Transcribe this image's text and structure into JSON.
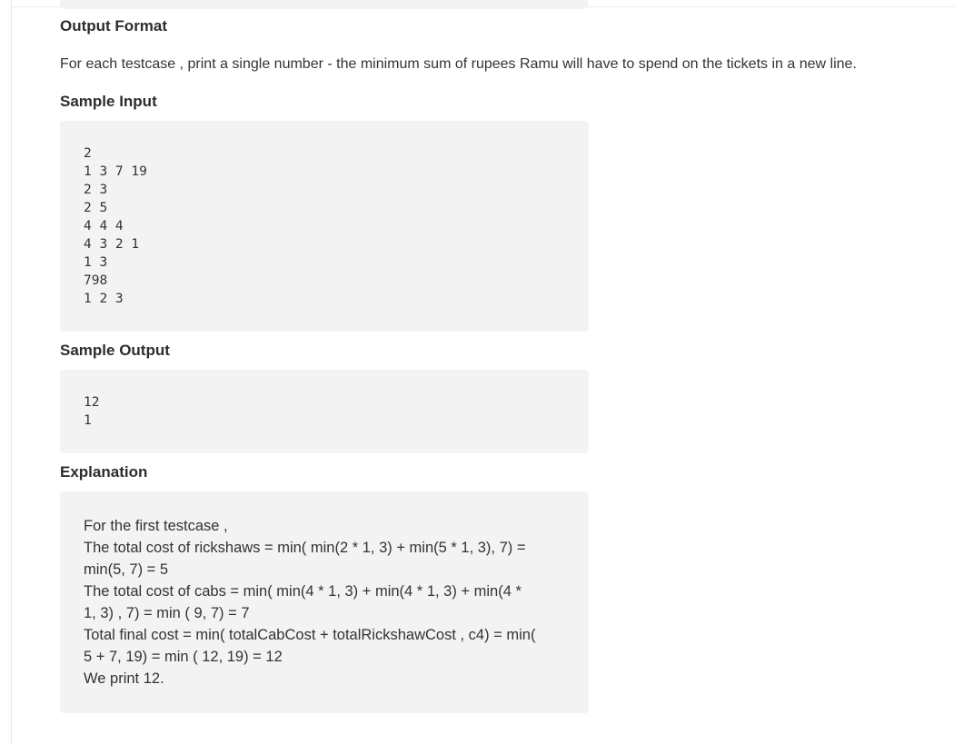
{
  "output_format": {
    "heading": "Output Format",
    "text": "For each testcase , print a single number - the minimum sum of rupees Ramu will have to spend on the tickets in a new line."
  },
  "sample_input": {
    "heading": "Sample Input",
    "code": "2\n1 3 7 19\n2 3\n2 5\n4 4 4\n4 3 2 1\n1 3\n798\n1 2 3"
  },
  "sample_output": {
    "heading": "Sample Output",
    "code": "12\n1"
  },
  "explanation": {
    "heading": "Explanation",
    "lines": [
      "For the first testcase ,",
      "The total cost of rickshaws = min( min(2 * 1, 3) + min(5 * 1, 3), 7) =",
      "min(5, 7) = 5",
      "The total cost of cabs = min( min(4 * 1, 3) + min(4 * 1, 3) + min(4 *",
      "1, 3) , 7) = min ( 9, 7) = 7",
      "Total final cost = min( totalCabCost + totalRickshawCost , c4) = min(",
      "5 + 7, 19) = min ( 12, 19) = 12",
      "We print 12."
    ]
  }
}
